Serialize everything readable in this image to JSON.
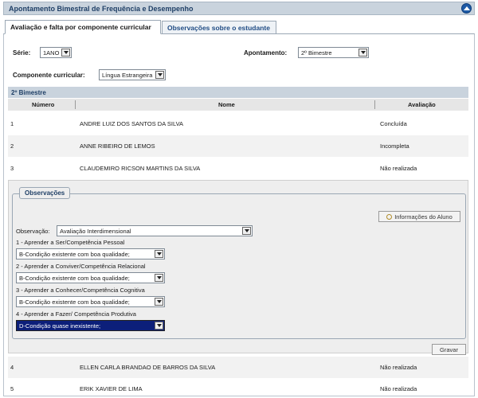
{
  "title": "Apontamento Bimestral de Frequência e Desempenho",
  "tabs": [
    {
      "label": "Avaliação e falta por componente curricular"
    },
    {
      "label": "Observações sobre o estudante"
    }
  ],
  "filters": {
    "serie_label": "Série:",
    "serie_value": "1ANO",
    "apontamento_label": "Apontamento:",
    "apontamento_value": "2º Bimestre",
    "componente_label": "Componente curricular:",
    "componente_value": "Língua Estrangeira"
  },
  "section_title": "2º Bimestre",
  "table": {
    "headers": [
      "Número",
      "Nome",
      "Avaliação"
    ],
    "rows_top": [
      {
        "num": "1",
        "name": "ANDRE LUIZ DOS SANTOS DA SILVA",
        "status": "Concluída"
      },
      {
        "num": "2",
        "name": "ANNE RIBEIRO DE LEMOS",
        "status": "Incompleta"
      },
      {
        "num": "3",
        "name": "CLAUDEMIRO RICSON MARTINS DA SILVA",
        "status": "Não realizada"
      }
    ],
    "rows_bottom": [
      {
        "num": "4",
        "name": "ELLEN CARLA BRANDAO DE BARROS DA SILVA",
        "status": "Não realizada"
      },
      {
        "num": "5",
        "name": "ERIK XAVIER DE LIMA",
        "status": "Não realizada"
      }
    ]
  },
  "observacoes": {
    "legend": "Observações",
    "info_button": "Informações do Aluno",
    "observacao_label": "Observação:",
    "observacao_value": "Avaliação Interdimensional",
    "questions": [
      {
        "label": "1 - Aprender a Ser/Competência Pessoal",
        "value": "B-Condição existente com boa qualidade;"
      },
      {
        "label": "2 - Aprender a Conviver/Competência Relacional",
        "value": "B-Condição existente com boa qualidade;"
      },
      {
        "label": "3 - Aprender a Conhecer/Competência Cognitiva",
        "value": "B-Condição existente com boa qualidade;"
      },
      {
        "label": "4 - Aprender a Fazer/ Competência Produtiva",
        "value": "D-Condição quase inexistente;"
      }
    ],
    "save_button": "Gravar"
  },
  "colors": {
    "header_bg": "#c9d3dd",
    "accent_blue": "#1f3f66",
    "selected_bg": "#0c1f7a"
  }
}
